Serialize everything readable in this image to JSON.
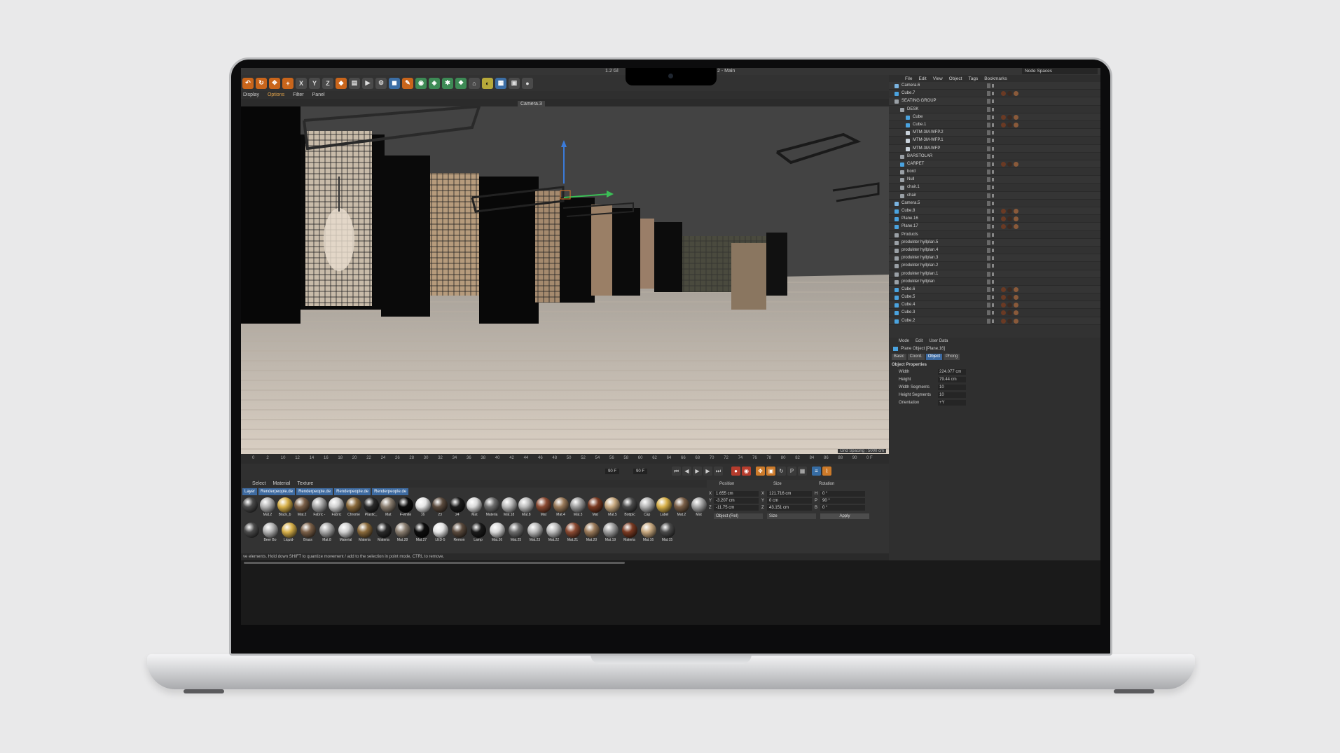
{
  "app": {
    "title_left": "1.2 Gl",
    "title_right": "2 - Main"
  },
  "toolbar": {
    "x": "X",
    "y": "Y",
    "z": "Z"
  },
  "viewport_menu": [
    "Display",
    "Options",
    "Filter",
    "Panel"
  ],
  "viewport": {
    "camera": "Camera.3",
    "grid_spacing": "Grid Spacing : 5000 cm"
  },
  "timeline": {
    "ticks": [
      "0",
      "2",
      "10",
      "12",
      "14",
      "16",
      "18",
      "20",
      "22",
      "24",
      "26",
      "28",
      "30",
      "32",
      "34",
      "36",
      "38",
      "40",
      "42",
      "44",
      "46",
      "48",
      "50",
      "52",
      "54",
      "56",
      "58",
      "60",
      "62",
      "64",
      "66",
      "68",
      "70",
      "72",
      "74",
      "76",
      "78",
      "80",
      "82",
      "84",
      "86",
      "88",
      "90"
    ],
    "current_frame": "0 F",
    "end_frame": "90 F",
    "end_frame2": "90 F"
  },
  "material_manager": {
    "menu": [
      "Select",
      "Material",
      "Texture"
    ],
    "layers": [
      "Layer",
      "Renderpeople.de",
      "Renderpeople.de",
      "Renderpeople.de",
      "Renderpeople.de"
    ],
    "row1": [
      "",
      "Mat.2",
      "Black_b",
      "Mat.2",
      "Fabric -",
      "Fabric",
      "Chrome",
      "Plastic_",
      "Mat",
      "F-white",
      "16",
      "23",
      "24",
      "Mat",
      "Materia",
      "Mat.18",
      "Mat.8",
      "Mat",
      "Mat.4",
      "Mat.3",
      "Mat",
      "Mat.5",
      "Bottpic",
      "Cap",
      "Label",
      "Mat.2",
      "Mat"
    ],
    "row2": [
      "",
      "Beer Bo",
      "Liquid-",
      "Brass",
      "Mat.8",
      "Material",
      "Materia",
      "Materia",
      "Mat.28",
      "Mat.27",
      "LED-5",
      "Remon",
      "Lamp",
      "Mat.26",
      "Mat.25",
      "Mat.23",
      "Mat.22",
      "Mat.21",
      "Mat.20",
      "Mat.19",
      "Materia",
      "Mat.16",
      "Mat.15"
    ]
  },
  "coordinates": {
    "headers": [
      "Position",
      "Size",
      "Rotation"
    ],
    "pos": {
      "x": "1.655 cm",
      "y": "-3.207 cm",
      "z": "-11.75 cm"
    },
    "size": {
      "x": "121.716 cm",
      "y": "0 cm",
      "z": "43.151 cm"
    },
    "rot": {
      "h": "0 °",
      "p": "90 °",
      "b": "0 °"
    },
    "labels": {
      "x": "X",
      "y": "Y",
      "z": "Z",
      "h": "H",
      "p": "P",
      "b": "B"
    },
    "mode": "Object (Rel)",
    "size_mode": "Size",
    "apply": "Apply"
  },
  "status_bar": "ve elements. Hold down SHIFT to quantize movement / add to the selection in point mode, CTRL to remove.",
  "object_manager": {
    "menu": [
      "File",
      "Edit",
      "View",
      "Object",
      "Tags",
      "Bookmarks"
    ],
    "node_spaces": "Node Spaces",
    "objects": [
      {
        "name": "Camera.6",
        "indent": 0,
        "color": "#7ab3e0"
      },
      {
        "name": "Cube.7",
        "indent": 0,
        "color": "#4aa3df"
      },
      {
        "name": "SEATING GROUP",
        "indent": 0,
        "color": "#9aa0a6"
      },
      {
        "name": "DESK",
        "indent": 1,
        "color": "#9aa0a6"
      },
      {
        "name": "Cube",
        "indent": 2,
        "color": "#4aa3df"
      },
      {
        "name": "Cube.1",
        "indent": 2,
        "color": "#4aa3df"
      },
      {
        "name": "MTM-3M-WFP.2",
        "indent": 2,
        "color": "#c9d2db"
      },
      {
        "name": "MTM-3M-WFP.1",
        "indent": 2,
        "color": "#c9d2db"
      },
      {
        "name": "MTM-3M-WFP",
        "indent": 2,
        "color": "#c9d2db"
      },
      {
        "name": "BARSTOLAR",
        "indent": 1,
        "color": "#9aa0a6"
      },
      {
        "name": "CARPET",
        "indent": 1,
        "color": "#4aa3df"
      },
      {
        "name": "bord",
        "indent": 1,
        "color": "#9aa0a6"
      },
      {
        "name": "Null",
        "indent": 1,
        "color": "#9aa0a6"
      },
      {
        "name": "chair.1",
        "indent": 1,
        "color": "#9aa0a6"
      },
      {
        "name": "chair",
        "indent": 1,
        "color": "#9aa0a6"
      },
      {
        "name": "Camera.5",
        "indent": 0,
        "color": "#7ab3e0"
      },
      {
        "name": "Cube.8",
        "indent": 0,
        "color": "#4aa3df"
      },
      {
        "name": "Plane.16",
        "indent": 0,
        "color": "#4aa3df"
      },
      {
        "name": "Plane.17",
        "indent": 0,
        "color": "#4aa3df"
      },
      {
        "name": "Products",
        "indent": 0,
        "color": "#9aa0a6"
      },
      {
        "name": "produkter hyllplan.5",
        "indent": 0,
        "color": "#9aa0a6"
      },
      {
        "name": "produkter hyllplan.4",
        "indent": 0,
        "color": "#9aa0a6"
      },
      {
        "name": "produkter hyllplan.3",
        "indent": 0,
        "color": "#9aa0a6"
      },
      {
        "name": "produkter hyllplan.2",
        "indent": 0,
        "color": "#9aa0a6"
      },
      {
        "name": "produkter hyllplan.1",
        "indent": 0,
        "color": "#9aa0a6"
      },
      {
        "name": "produkter hyllplan",
        "indent": 0,
        "color": "#9aa0a6"
      },
      {
        "name": "Cube.6",
        "indent": 0,
        "color": "#4aa3df"
      },
      {
        "name": "Cube.5",
        "indent": 0,
        "color": "#4aa3df"
      },
      {
        "name": "Cube.4",
        "indent": 0,
        "color": "#4aa3df"
      },
      {
        "name": "Cube.3",
        "indent": 0,
        "color": "#4aa3df"
      },
      {
        "name": "Cube.2",
        "indent": 0,
        "color": "#4aa3df"
      }
    ]
  },
  "attributes": {
    "menu": [
      "Mode",
      "Edit",
      "User Data"
    ],
    "object_title": "Plane Object [Plane.16]",
    "tabs": [
      "Basic",
      "Coord.",
      "Object",
      "Phong"
    ],
    "section": "Object Properties",
    "props": [
      {
        "label": "Width",
        "value": "224.077 cm"
      },
      {
        "label": "Height",
        "value": "79.44 cm"
      },
      {
        "label": "Width Segments",
        "value": "10"
      },
      {
        "label": "Height Segments",
        "value": "10"
      },
      {
        "label": "Orientation",
        "value": "+Y"
      }
    ]
  }
}
